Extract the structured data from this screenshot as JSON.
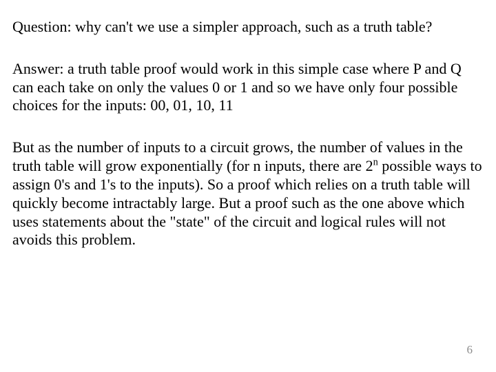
{
  "question_text": "Question:  why can't we use a simpler approach, such as a truth table?",
  "answer_text": "Answer:  a truth table proof would work in this simple case where P and Q can each take on only the values 0 or 1 and so we have only four possible choices for the inputs: 00, 01, 10, 11",
  "explain_pre": "But as the number of inputs to a circuit grows, the number of values in the truth table will grow exponentially (for n inputs, there are 2",
  "explain_exp": "n",
  "explain_post": " possible ways to assign 0's and 1's to the inputs).  So a proof which relies on a truth table will quickly become intractably large.  But a proof such as the one above which uses statements about the \"state\" of the circuit and logical rules will not avoids this problem.",
  "page_number": "6"
}
